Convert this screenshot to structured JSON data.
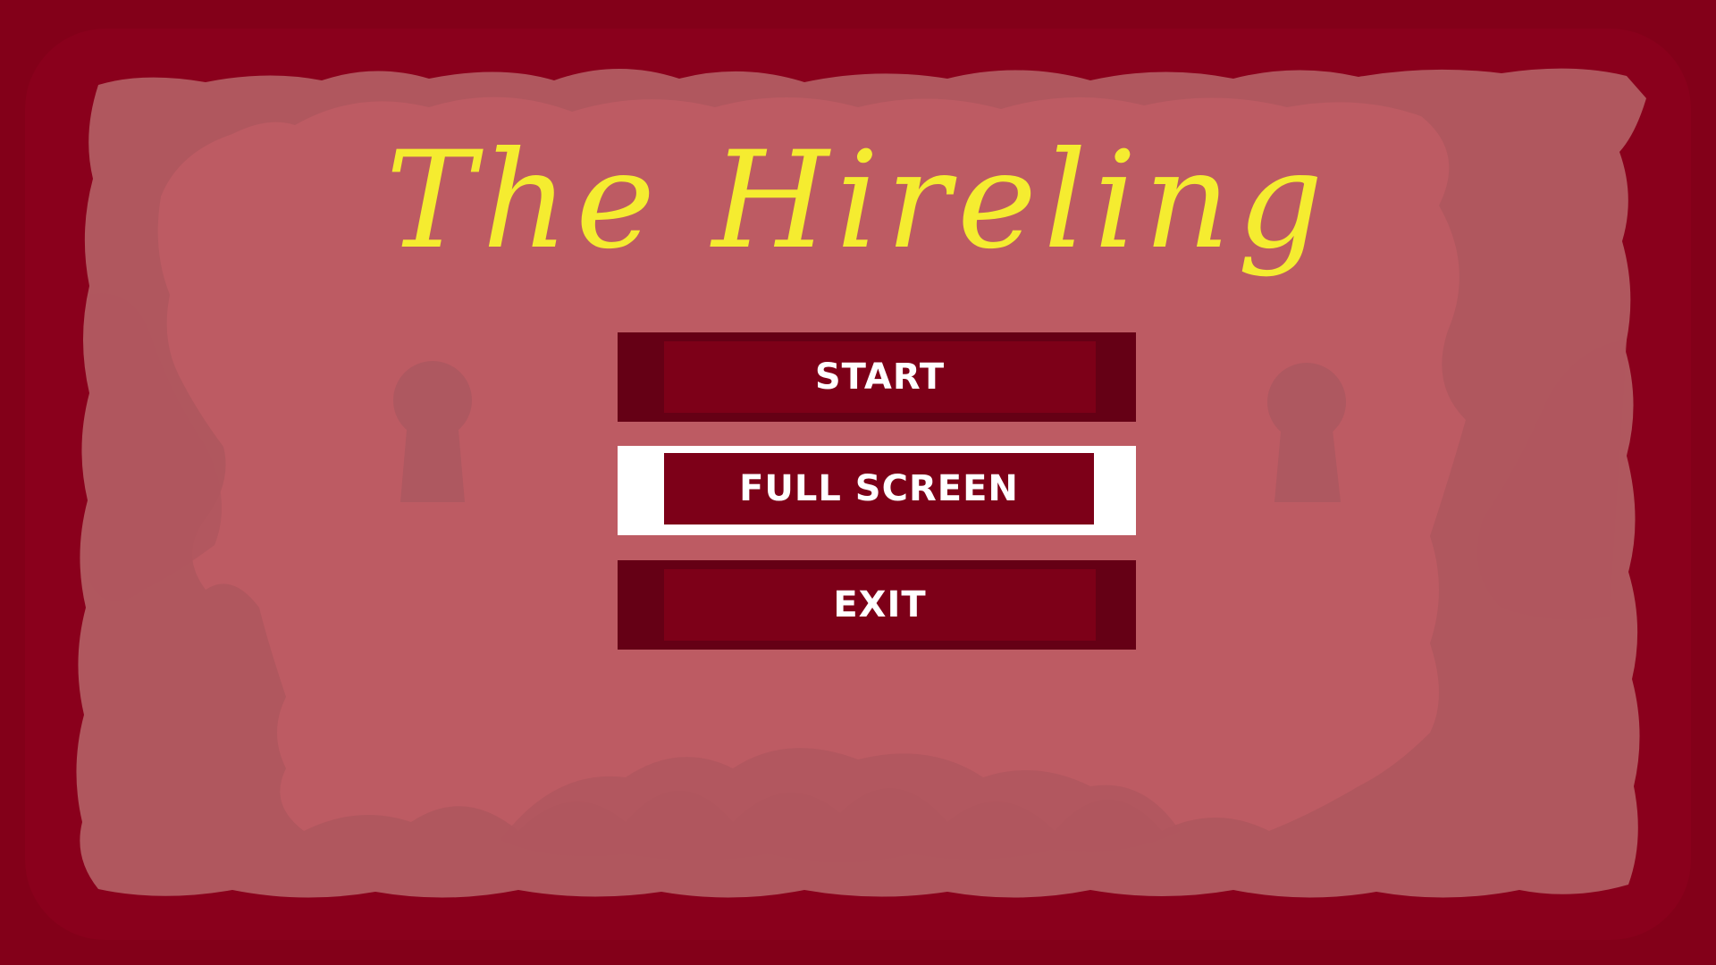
{
  "game": {
    "title": "The Hireling"
  },
  "menu": {
    "items": [
      {
        "label": "Start",
        "selected": false
      },
      {
        "label": "Full Screen",
        "selected": true
      },
      {
        "label": "Exit",
        "selected": false
      }
    ]
  },
  "colors": {
    "frame": "#830019",
    "parchment_outer": "#b0575e",
    "parchment_inner": "#bd5b63",
    "title": "#f5ec30",
    "button_edge": "#650015",
    "button_face": "#7d0018",
    "button_selected_border": "#ffffff",
    "button_text": "#ffffff"
  },
  "icons": {
    "left_keyhole": "keyhole-icon",
    "right_keyhole": "keyhole-icon"
  }
}
